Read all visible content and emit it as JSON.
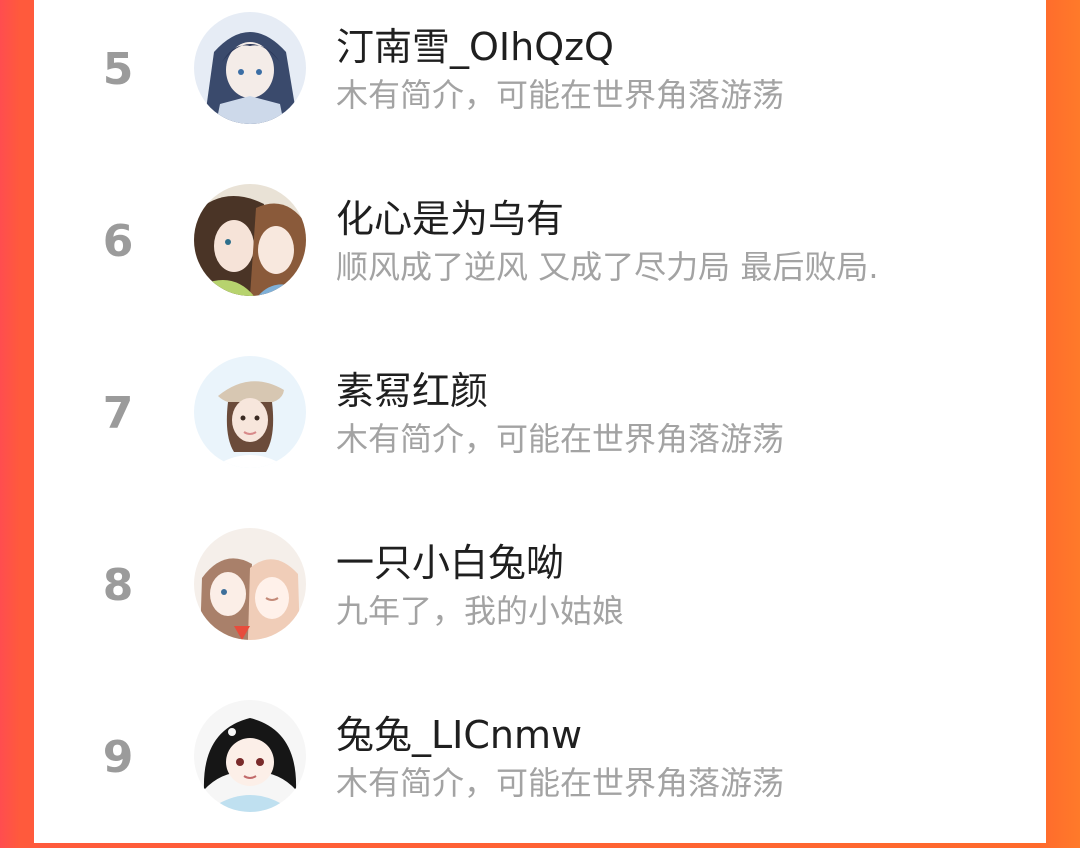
{
  "colors": {
    "accent_left": "#ff4d4f",
    "accent_right": "#ff7a2a",
    "rank_text": "#9b9b9b",
    "name_text": "#1f1f1f",
    "bio_text": "#a3a3a3"
  },
  "users": [
    {
      "rank": "5",
      "name": "汀南雪_OIhQzQ",
      "bio": "木有简介，可能在世界角落游荡",
      "avatar_icon": "anime-girl-dark-hair-avatar"
    },
    {
      "rank": "6",
      "name": "化心是为乌有",
      "bio": "顺风成了逆风 又成了尽力局 最后败局.",
      "avatar_icon": "anime-couple-avatar"
    },
    {
      "rank": "7",
      "name": "素冩红颜",
      "bio": "木有简介，可能在世界角落游荡",
      "avatar_icon": "girl-beret-photo-avatar"
    },
    {
      "rank": "8",
      "name": "一只小白兔呦",
      "bio": "九年了，我的小姑娘",
      "avatar_icon": "anime-two-girls-avatar"
    },
    {
      "rank": "9",
      "name": "兔兔_LICnmw",
      "bio": "木有简介，可能在世界角落游荡",
      "avatar_icon": "anime-black-hair-girl-avatar"
    }
  ]
}
